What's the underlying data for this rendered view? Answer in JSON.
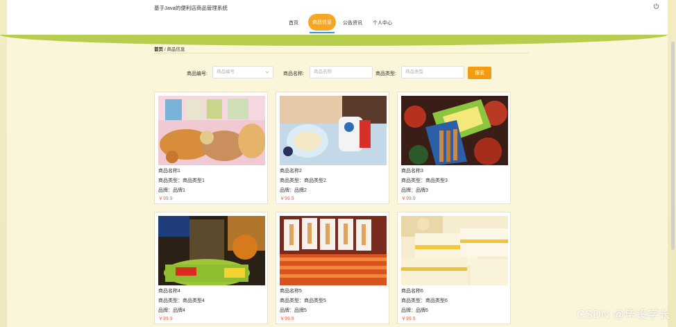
{
  "header": {
    "title": "基于Java的便利店商品管理系统",
    "nav": [
      "首页",
      "商品信息",
      "公告资讯",
      "个人中心"
    ],
    "active_index": 1
  },
  "breadcrumb": {
    "home": "首页",
    "sep": "/",
    "current": "商品信息"
  },
  "search": {
    "code_label": "商品编号:",
    "code_placeholder": "商品编号",
    "name_label": "商品名称:",
    "name_placeholder": "商品名称",
    "type_label": "商品类型:",
    "type_placeholder": "商品类型",
    "button": "搜索"
  },
  "products": [
    {
      "name": "商品名称1",
      "type": "商品类型：商品类型1",
      "brand": "品牌：品牌1",
      "price": "￥99.9"
    },
    {
      "name": "商品名称2",
      "type": "商品类型：商品类型2",
      "brand": "品牌：品牌2",
      "price": "￥99.9"
    },
    {
      "name": "商品名称3",
      "type": "商品类型：商品类型3",
      "brand": "品牌：品牌3",
      "price": "￥99.9"
    },
    {
      "name": "商品名称4",
      "type": "商品类型：商品类型4",
      "brand": "品牌：品牌4",
      "price": "￥99.9"
    },
    {
      "name": "商品名称5",
      "type": "商品类型：商品类型5",
      "brand": "品牌：品牌5",
      "price": "￥99.9"
    },
    {
      "name": "商品名称6",
      "type": "商品类型：商品类型6",
      "brand": "品牌：品牌6",
      "price": "￥99.9"
    }
  ],
  "watermark": "CSDN @毕设学长",
  "colors": {
    "accent": "#f5a623",
    "band": "#b7cd4f",
    "price": "#e06c4b",
    "background": "#fbf6d9"
  }
}
